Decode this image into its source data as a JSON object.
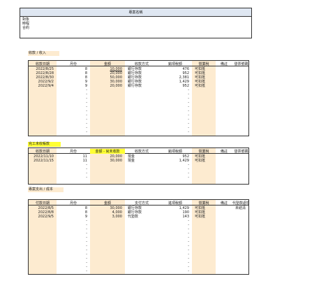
{
  "project": {
    "title": "專案名稱",
    "lines": [
      "對象",
      "時程",
      "合約"
    ]
  },
  "income": {
    "label": "收款 / 收入",
    "headers": [
      "收款日期",
      "月份",
      "金額",
      "收款方式",
      "銷項稅額",
      "營業稅",
      "備註",
      "發票號碼"
    ],
    "rows": [
      {
        "date": "2022/8/25",
        "month": "8",
        "amount": "10,000",
        "method": "銀行存款",
        "tax": "476",
        "vat": "可扣抵",
        "note": "",
        "invoice": ""
      },
      {
        "date": "2022/8/28",
        "month": "8",
        "amount": "20,000",
        "method": "銀行存款",
        "tax": "952",
        "vat": "可扣抵",
        "note": "",
        "invoice": ""
      },
      {
        "date": "2022/8/30",
        "month": "8",
        "amount": "50,000",
        "method": "銀行存款",
        "tax": "2,381",
        "vat": "可扣抵",
        "note": "",
        "invoice": ""
      },
      {
        "date": "2022/9/2",
        "month": "9",
        "amount": "30,000",
        "method": "銀行存款",
        "tax": "1,429",
        "vat": "可扣抵",
        "note": "",
        "invoice": ""
      },
      {
        "date": "2022/9/4",
        "month": "9",
        "amount": "20,000",
        "method": "銀行存款",
        "tax": "952",
        "vat": "可扣抵",
        "note": "",
        "invoice": ""
      }
    ],
    "empty_dash": "-"
  },
  "unbilled": {
    "label": "完工未收帳款",
    "headers": [
      "收款日期",
      "月份",
      "金額 - 尚未收款",
      "收款方式",
      "銷項稅額",
      "營業稅",
      "備註",
      "發票號碼"
    ],
    "rows": [
      {
        "date": "2022/11/10",
        "month": "11",
        "amount": "20,000",
        "method": "現金",
        "tax": "952",
        "vat": "可扣抵",
        "note": "",
        "invoice": ""
      },
      {
        "date": "2022/11/15",
        "month": "11",
        "amount": "30,000",
        "method": "現金",
        "tax": "1,429",
        "vat": "可扣抵",
        "note": "",
        "invoice": ""
      }
    ],
    "empty_dash": "-"
  },
  "expense": {
    "label": "專案支出 / 成本",
    "headers": [
      "付款日期",
      "月份",
      "金額",
      "支付方式",
      "進項稅額",
      "營業稅",
      "備註",
      "代墊款處理"
    ],
    "rows": [
      {
        "date": "2022/8/5",
        "month": "8",
        "amount": "30,000",
        "method": "銀行存款",
        "tax": "1,429",
        "vat": "可扣抵",
        "note": "",
        "invoice": "未結清"
      },
      {
        "date": "2022/8/8",
        "month": "8",
        "amount": "4,000",
        "method": "銀行存款",
        "tax": "190",
        "vat": "可扣抵",
        "note": "",
        "invoice": ""
      },
      {
        "date": "2022/9/5",
        "month": "9",
        "amount": "3,000",
        "method": "代墊款",
        "tax": "143",
        "vat": "可扣抵",
        "note": "",
        "invoice": ""
      }
    ],
    "empty_dash": "-"
  },
  "colors": {
    "highlight_column": "#fdebd0",
    "label_yellow": "#ffff33",
    "header_blue": "#dfe7f2"
  }
}
